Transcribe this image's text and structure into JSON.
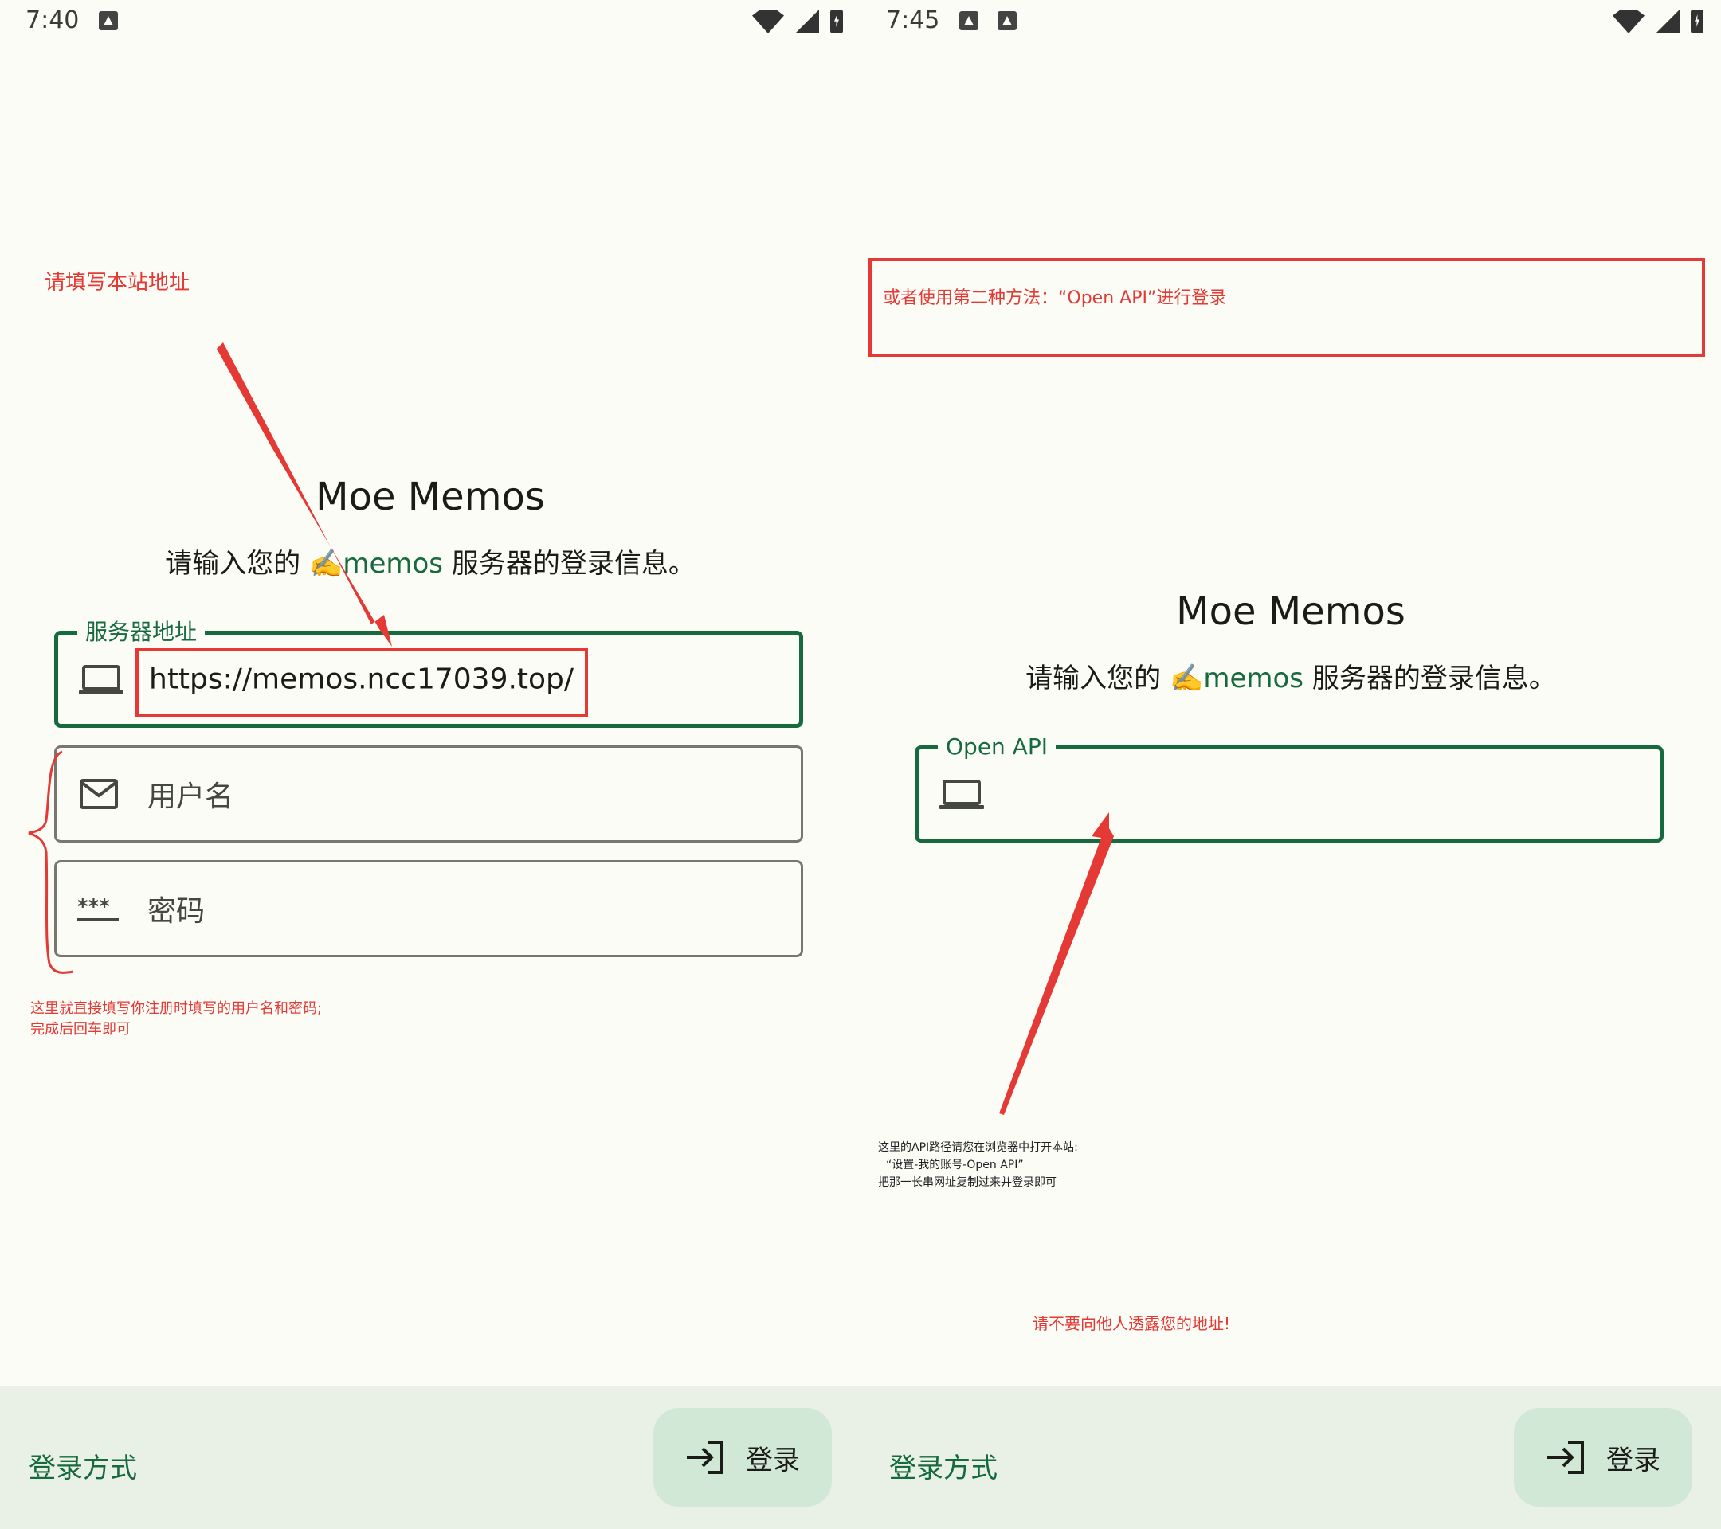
{
  "left": {
    "status": {
      "time": "7:40",
      "icons": [
        "a-icon"
      ]
    },
    "app_title": "Moe Memos",
    "subtitle": {
      "prefix": "请输入您的 ",
      "emoji": "✍️",
      "brand": "memos",
      "suffix": " 服务器的登录信息。"
    },
    "server_field": {
      "label": "服务器地址",
      "value": "https://memos.ncc17039.top/"
    },
    "username_field": {
      "placeholder": "用户名"
    },
    "password_field": {
      "placeholder": "密码"
    },
    "bottom": {
      "login_method": "登录方式",
      "login_button": "登录"
    },
    "annotations": {
      "fill_site": "请填写本站地址",
      "note_line1": "这里就直接填写你注册时填写的用户名和密码;",
      "note_line2": "完成后回车即可"
    }
  },
  "right": {
    "status": {
      "time": "7:45",
      "icons": [
        "image-icon",
        "a-icon"
      ]
    },
    "app_title": "Moe Memos",
    "subtitle": {
      "prefix": "请输入您的 ",
      "emoji": "✍️",
      "brand": "memos",
      "suffix": " 服务器的登录信息。"
    },
    "api_field": {
      "label": "Open API",
      "value": ""
    },
    "bottom": {
      "login_method": "登录方式",
      "login_button": "登录"
    },
    "annotations": {
      "method2": "或者使用第二种方法：“Open API”进行登录",
      "api_line1": "这里的API路径请您在浏览器中打开本站:",
      "api_line2": "“设置-我的账号-Open API”",
      "api_line3": "把那一长串网址复制过来并登录即可",
      "warning": "请不要向他人透露您的地址!"
    }
  },
  "colors": {
    "primary": "#17693e",
    "annotation": "#e53935",
    "background": "#fbfcf6",
    "bottom_bar": "#e9f1e7",
    "button": "#d2e8d6"
  }
}
